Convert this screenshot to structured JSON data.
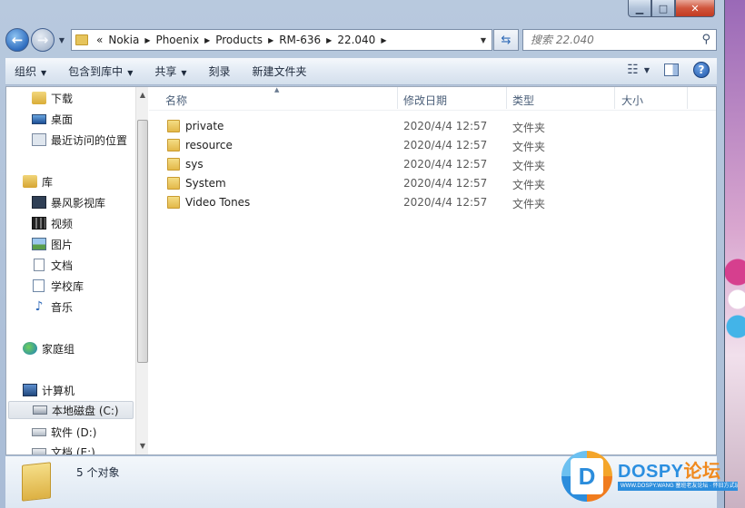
{
  "window": {
    "controls": {
      "min": "▁",
      "max": "□",
      "close": "✕"
    }
  },
  "address_bar": {
    "overflow": "«",
    "crumbs": [
      "Nokia",
      "Phoenix",
      "Products",
      "RM-636",
      "22.040"
    ],
    "search_placeholder": "搜索 22.040"
  },
  "toolbar": {
    "organize": "组织",
    "include_in_library": "包含到库中",
    "share": "共享",
    "burn": "刻录",
    "new_folder": "新建文件夹"
  },
  "nav_pane": {
    "items": [
      {
        "label": "下载",
        "icon": "download-folder-icon"
      },
      {
        "label": "桌面",
        "icon": "desktop-icon"
      },
      {
        "label": "最近访问的位置",
        "icon": "recent-places-icon"
      },
      {
        "label": "库",
        "icon": "library-icon"
      },
      {
        "label": "暴风影视库",
        "icon": "video-library-icon"
      },
      {
        "label": "视频",
        "icon": "videos-icon"
      },
      {
        "label": "图片",
        "icon": "pictures-icon"
      },
      {
        "label": "文档",
        "icon": "documents-icon"
      },
      {
        "label": "学校库",
        "icon": "school-library-icon"
      },
      {
        "label": "音乐",
        "icon": "music-icon"
      },
      {
        "label": "家庭组",
        "icon": "homegroup-icon"
      },
      {
        "label": "计算机",
        "icon": "computer-icon"
      },
      {
        "label": "本地磁盘 (C:)",
        "icon": "local-disk-icon"
      },
      {
        "label": "软件 (D:)",
        "icon": "drive-icon"
      },
      {
        "label": "文档 (E:)",
        "icon": "drive-icon"
      }
    ]
  },
  "file_list": {
    "columns": {
      "name": "名称",
      "modified": "修改日期",
      "type": "类型",
      "size": "大小"
    },
    "rows": [
      {
        "name": "private",
        "modified": "2020/4/4 12:57",
        "type": "文件夹"
      },
      {
        "name": "resource",
        "modified": "2020/4/4 12:57",
        "type": "文件夹"
      },
      {
        "name": "sys",
        "modified": "2020/4/4 12:57",
        "type": "文件夹"
      },
      {
        "name": "System",
        "modified": "2020/4/4 12:57",
        "type": "文件夹"
      },
      {
        "name": "Video Tones",
        "modified": "2020/4/4 12:57",
        "type": "文件夹"
      }
    ]
  },
  "details": {
    "count": "5 个对象"
  },
  "watermark": {
    "logo_letter": "D",
    "brand": "DOSPY",
    "brand_cn": "论坛",
    "sub": "WWW.DOSPY.WANG 塞班老友论坛 · 怀旧方式玩"
  }
}
